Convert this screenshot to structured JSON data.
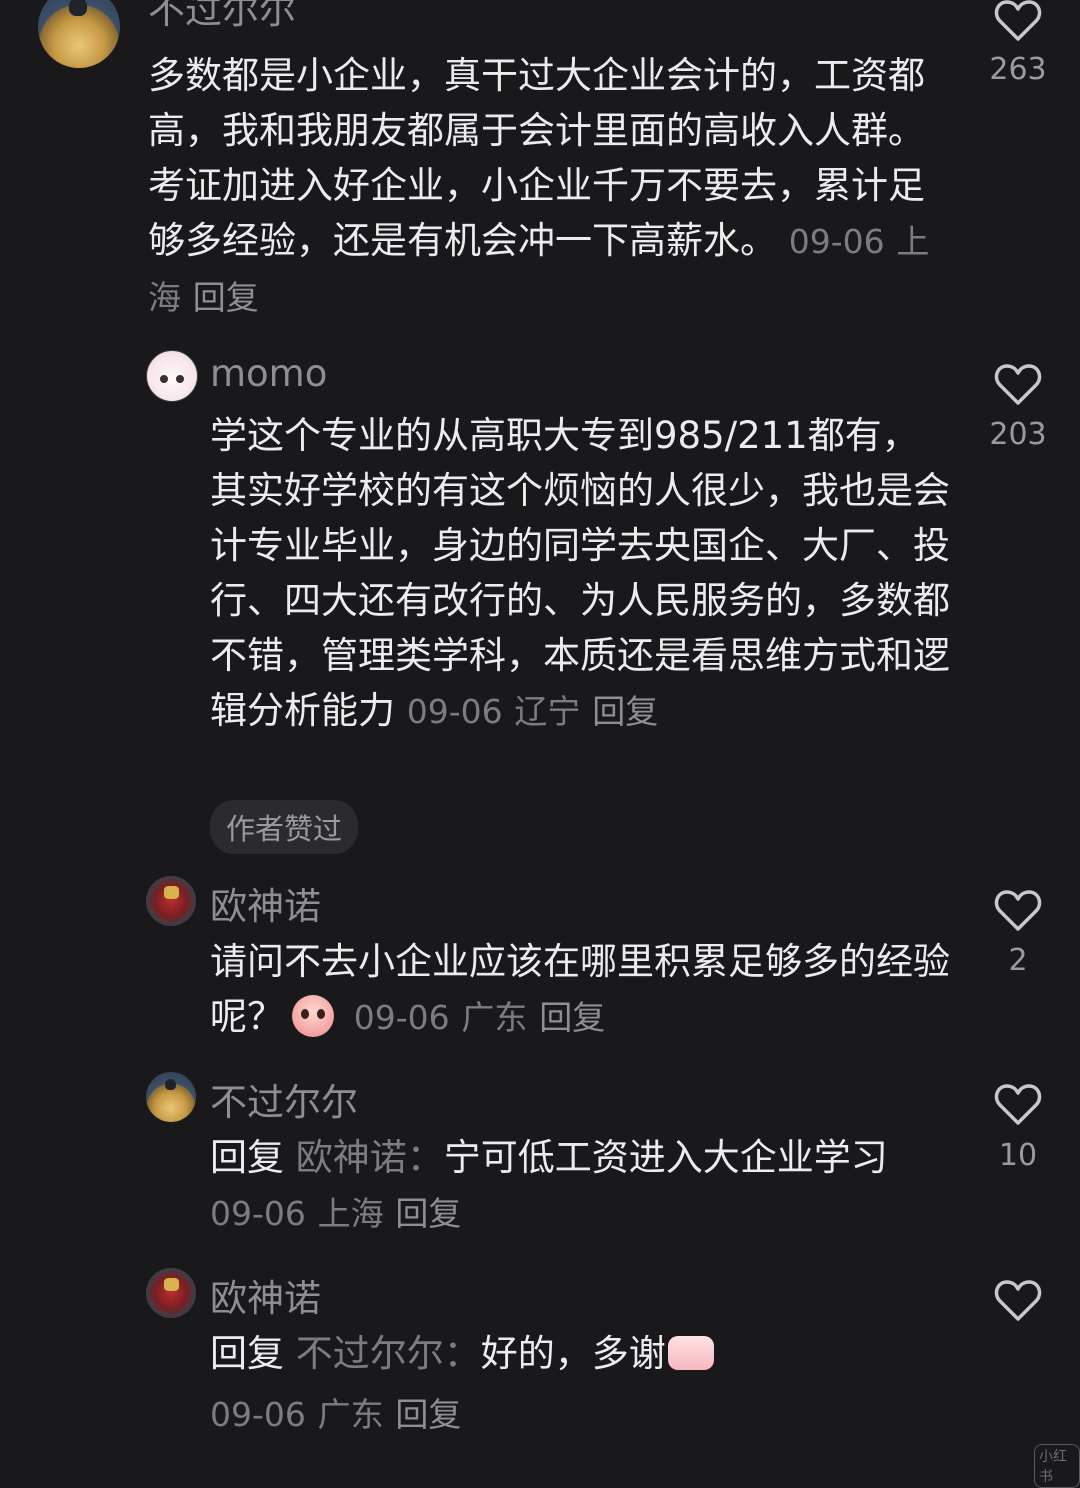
{
  "comments": [
    {
      "author": "不过尔尔",
      "text": "多数都是小企业，真干过大企业会计的，工资都高，我和我朋友都属于会计里面的高收入人群。考证加进入好企业，小企业千万不要去，累计足够多经验，还是有机会冲一下高薪水。",
      "date": "09-06",
      "location": "上海",
      "reply_label": "回复",
      "likes": "263"
    },
    {
      "author": "momo",
      "text": "学这个专业的从高职大专到985/211都有，其实好学校的有这个烦恼的人很少，我也是会计专业毕业，身边的同学去央国企、大厂、投行、四大还有改行的、为人民服务的，多数都不错，管理类学科，本质还是看思维方式和逻辑分析能力",
      "date": "09-06",
      "location": "辽宁",
      "reply_label": "回复",
      "likes": "203",
      "badge": "作者赞过"
    },
    {
      "author": "欧神诺",
      "text": "请问不去小企业应该在哪里积累足够多的经验呢？",
      "emoji": "pleading-face-emoji",
      "date": "09-06",
      "location": "广东",
      "reply_label": "回复",
      "likes": "2"
    },
    {
      "author": "不过尔尔",
      "reply_prefix": "回复",
      "reply_target": "欧神诺：",
      "text": "宁可低工资进入大企业学习",
      "date": "09-06",
      "location": "上海",
      "reply_label": "回复",
      "likes": "10"
    },
    {
      "author": "欧神诺",
      "reply_prefix": "回复",
      "reply_target": "不过尔尔：",
      "text": "好的，多谢",
      "emoji": "thumbs-up-emoji",
      "date": "09-06",
      "location": "广东",
      "reply_label": "回复",
      "likes": ""
    }
  ],
  "watermark": "小红书"
}
